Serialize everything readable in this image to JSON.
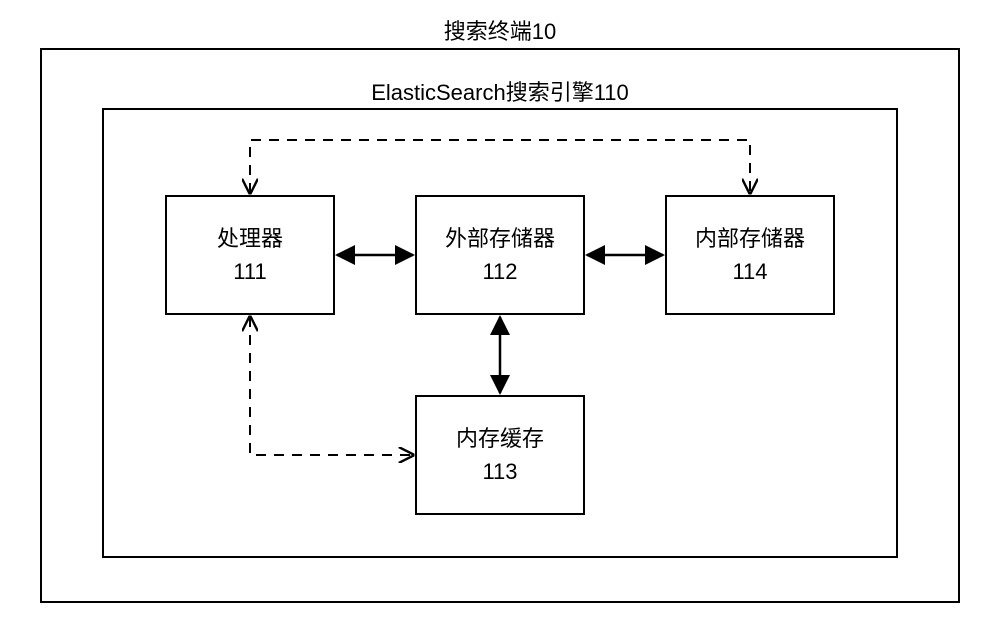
{
  "diagram": {
    "outer_title": "搜索终端10",
    "inner_title": "ElasticSearch搜索引擎110",
    "components": {
      "c111": {
        "label": "处理器",
        "num": "111"
      },
      "c112": {
        "label": "外部存储器",
        "num": "112"
      },
      "c113": {
        "label": "内存缓存",
        "num": "113"
      },
      "c114": {
        "label": "内部存储器",
        "num": "114"
      }
    },
    "connections": [
      {
        "from": "c111",
        "to": "c112",
        "style": "solid",
        "bidirectional": true
      },
      {
        "from": "c112",
        "to": "c114",
        "style": "solid",
        "bidirectional": true
      },
      {
        "from": "c112",
        "to": "c113",
        "style": "solid",
        "bidirectional": true
      },
      {
        "from": "c111",
        "to": "c114",
        "style": "dashed",
        "bidirectional": true,
        "routed": "top"
      },
      {
        "from": "c111",
        "to": "c113",
        "style": "dashed",
        "bidirectional": true,
        "routed": "bottom-left"
      }
    ]
  }
}
